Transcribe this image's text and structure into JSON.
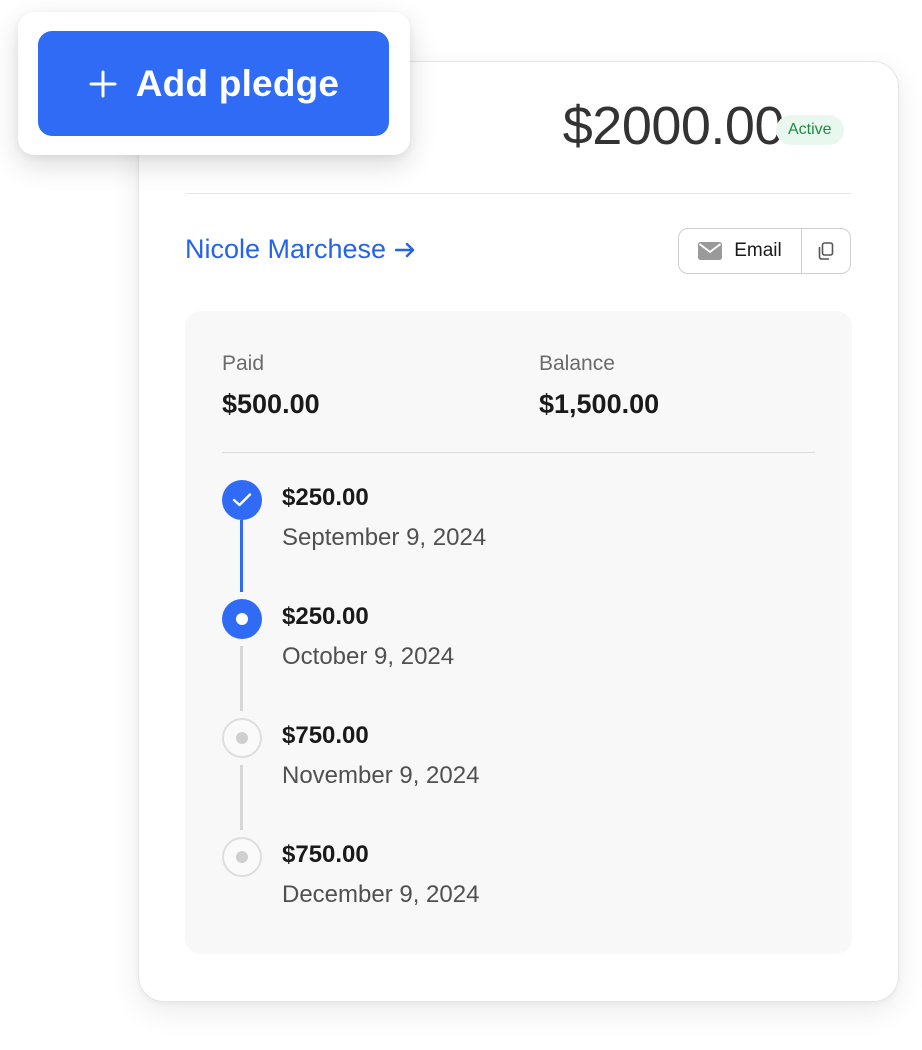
{
  "add_pledge": {
    "label": "Add pledge",
    "icon": "plus-icon"
  },
  "pledge": {
    "amount": "$2000.00",
    "status": "Active",
    "donor_name": "Nicole Marchese",
    "donor_arrow": "→"
  },
  "actions": {
    "email_label": "Email",
    "email_icon": "envelope-icon",
    "copy_icon": "copy-icon"
  },
  "summary": {
    "paid_label": "Paid",
    "paid_value": "$500.00",
    "balance_label": "Balance",
    "balance_value": "$1,500.00"
  },
  "schedule": [
    {
      "amount": "$250.00",
      "date": "September 9, 2024",
      "state": "paid"
    },
    {
      "amount": "$250.00",
      "date": "October 9, 2024",
      "state": "current"
    },
    {
      "amount": "$750.00",
      "date": "November 9, 2024",
      "state": "pending"
    },
    {
      "amount": "$750.00",
      "date": "December 9, 2024",
      "state": "pending"
    }
  ],
  "colors": {
    "accent": "#2f6bf5",
    "link": "#2563eb",
    "active_badge_bg": "#e9f8ef",
    "active_badge_text": "#1f8a45"
  }
}
